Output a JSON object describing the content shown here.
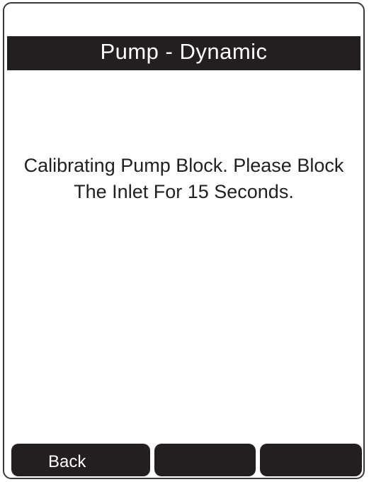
{
  "screen": {
    "title": "Pump - Dynamic",
    "message_line1": "Calibrating Pump Block. Please Block",
    "message_line2": "The Inlet For 15 Seconds."
  },
  "softkeys": {
    "left_label": "Back",
    "middle_label": "",
    "right_label": ""
  },
  "colors": {
    "bar_background": "#231f20",
    "text_dark": "#231f20",
    "text_light": "#ffffff",
    "screen_background": "#ffffff"
  }
}
